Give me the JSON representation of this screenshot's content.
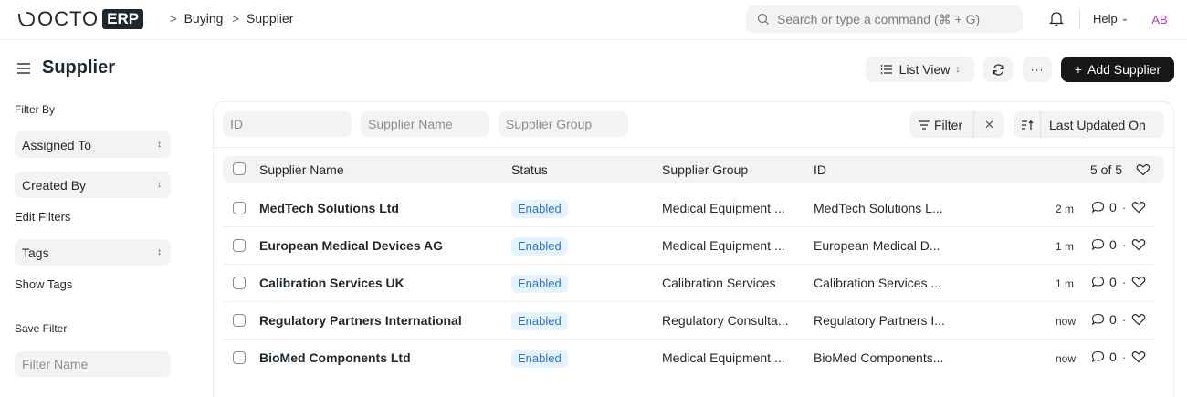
{
  "navbar": {
    "logo_text": "OCTO",
    "logo_badge": "ERP",
    "breadcrumbs": [
      "Buying",
      "Supplier"
    ],
    "search_placeholder": "Search or type a command (⌘ + G)",
    "help_label": "Help",
    "avatar_initials": "AB"
  },
  "page": {
    "title": "Supplier",
    "view_label": "List View",
    "more_label": "···",
    "add_label": "Add Supplier"
  },
  "sidebar": {
    "filter_by_label": "Filter By",
    "assigned_to": "Assigned To",
    "created_by": "Created By",
    "edit_filters": "Edit Filters",
    "tags": "Tags",
    "show_tags": "Show Tags",
    "save_filter_label": "Save Filter",
    "filter_name_placeholder": "Filter Name"
  },
  "filters": {
    "id_placeholder": "ID",
    "supplier_name_placeholder": "Supplier Name",
    "supplier_group_placeholder": "Supplier Group",
    "filter_label": "Filter",
    "clear_label": "✕",
    "sort_label": "Last Updated On"
  },
  "table": {
    "columns": {
      "name": "Supplier Name",
      "status": "Status",
      "group": "Supplier Group",
      "id": "ID"
    },
    "count": "5 of 5",
    "rows": [
      {
        "name": "MedTech Solutions Ltd",
        "status": "Enabled",
        "group": "Medical Equipment ...",
        "id": "MedTech Solutions L...",
        "time": "2 m",
        "comments": "0"
      },
      {
        "name": "European Medical Devices AG",
        "status": "Enabled",
        "group": "Medical Equipment ...",
        "id": "European Medical D...",
        "time": "1 m",
        "comments": "0"
      },
      {
        "name": "Calibration Services UK",
        "status": "Enabled",
        "group": "Calibration Services",
        "id": "Calibration Services ...",
        "time": "1 m",
        "comments": "0"
      },
      {
        "name": "Regulatory Partners International",
        "status": "Enabled",
        "group": "Regulatory Consulta...",
        "id": "Regulatory Partners I...",
        "time": "now",
        "comments": "0"
      },
      {
        "name": "BioMed Components Ltd",
        "status": "Enabled",
        "group": "Medical Equipment ...",
        "id": "BioMed Components...",
        "time": "now",
        "comments": "0"
      }
    ]
  },
  "colors": {
    "badge_bg": "#e6f2fd",
    "badge_text": "#2f73c9",
    "primary_button": "#171717",
    "avatar_text": "#b03fb7"
  },
  "icons": [
    "search-icon",
    "bell-icon",
    "hamburger-icon",
    "list-icon",
    "refresh-icon",
    "filter-icon",
    "sort-icon",
    "comment-icon",
    "heart-icon"
  ]
}
